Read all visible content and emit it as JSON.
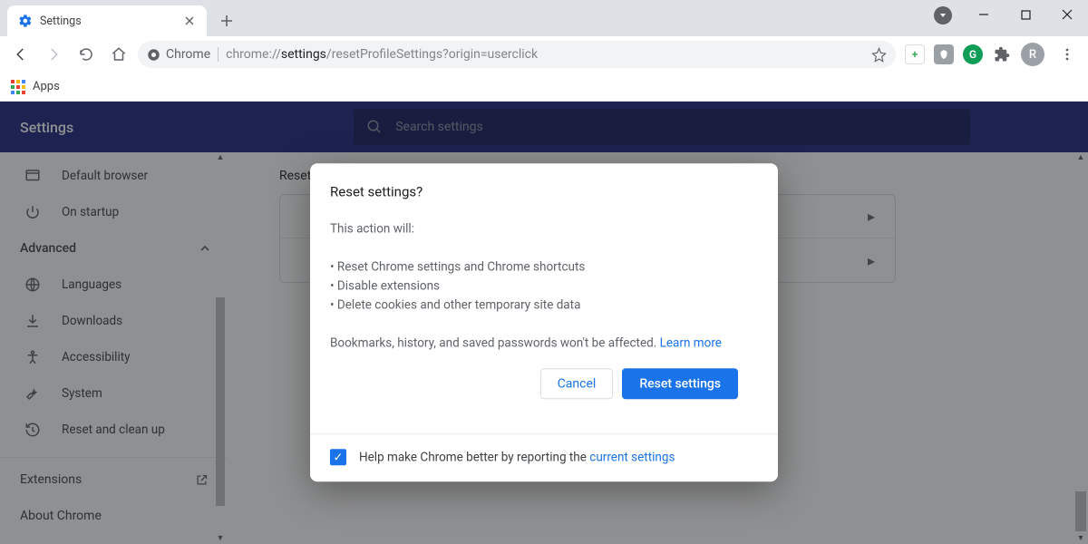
{
  "window": {
    "tab_title": "Settings",
    "profile_initial": "R"
  },
  "toolbar": {
    "site_label": "Chrome",
    "url_prefix": "chrome://",
    "url_bold": "settings",
    "url_rest": "/resetProfileSettings?origin=userclick"
  },
  "bookmarks": {
    "apps_label": "Apps"
  },
  "settings": {
    "app_title": "Settings",
    "search_placeholder": "Search settings",
    "sidebar": {
      "default_browser": "Default browser",
      "on_startup": "On startup",
      "advanced": "Advanced",
      "languages": "Languages",
      "downloads": "Downloads",
      "accessibility": "Accessibility",
      "system": "System",
      "reset": "Reset and clean up",
      "extensions": "Extensions",
      "about": "About Chrome"
    },
    "content_section_title": "Reset and clean up"
  },
  "dialog": {
    "title": "Reset settings?",
    "intro": "This action will:",
    "bullet1": "• Reset Chrome settings and Chrome shortcuts",
    "bullet2": "• Disable extensions",
    "bullet3": "• Delete cookies and other temporary site data",
    "note_prefix": "Bookmarks, history, and saved passwords won't be affected. ",
    "learn_more": "Learn more",
    "cancel": "Cancel",
    "confirm": "Reset settings",
    "footer_prefix": "Help make Chrome better by reporting the ",
    "footer_link": "current settings"
  }
}
